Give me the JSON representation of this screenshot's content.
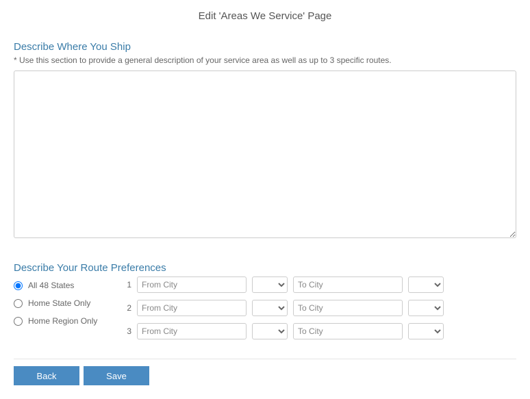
{
  "page_title": "Edit 'Areas We Service' Page",
  "section1": {
    "title": "Describe Where You Ship",
    "hint": "* Use this section to provide a general description of your service area as well as up to 3 specific routes.",
    "value": ""
  },
  "section2": {
    "title": "Describe Your Route Preferences",
    "radios": [
      {
        "label": "All 48 States",
        "checked": true
      },
      {
        "label": "Home State Only",
        "checked": false
      },
      {
        "label": "Home Region Only",
        "checked": false
      }
    ],
    "rows": [
      {
        "num": "1",
        "from_ph": "From City",
        "to_ph": "To City"
      },
      {
        "num": "2",
        "from_ph": "From City",
        "to_ph": "To City"
      },
      {
        "num": "3",
        "from_ph": "From City",
        "to_ph": "To City"
      }
    ]
  },
  "buttons": {
    "back": "Back",
    "save": "Save"
  }
}
